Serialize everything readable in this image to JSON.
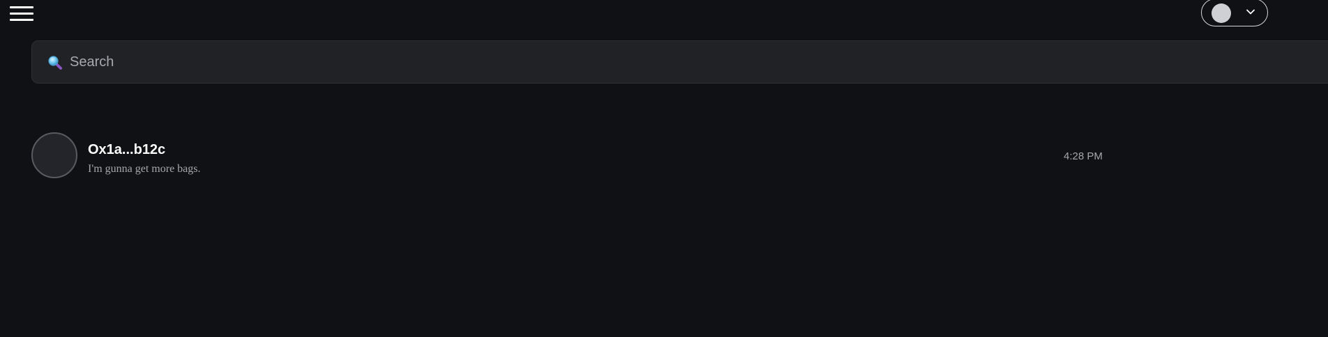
{
  "header": {
    "menu_icon": "hamburger-icon",
    "account": {
      "avatar_color": "#cfd0d3",
      "chevron_icon": "chevron-down-icon"
    }
  },
  "search": {
    "icon": "search-icon",
    "placeholder": "Search",
    "value": ""
  },
  "conversations": [
    {
      "name": "Ox1a...b12c",
      "preview": "I'm gunna get more bags.",
      "time": "4:28 PM"
    }
  ],
  "colors": {
    "background": "#101114",
    "surface": "#212226",
    "text_primary": "#ffffff",
    "text_secondary": "#a5a7ab"
  }
}
